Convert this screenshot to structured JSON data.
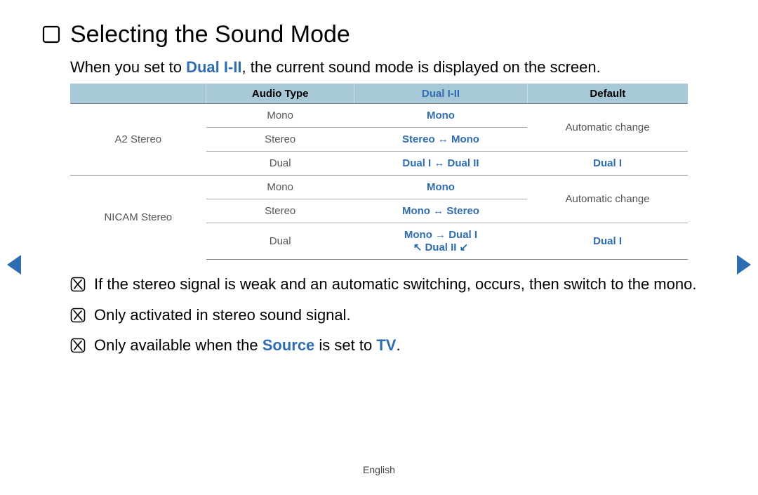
{
  "title": "Selecting the Sound Mode",
  "intro_prefix": "When you set to ",
  "intro_highlight": "Dual I-II",
  "intro_suffix": ", the current sound mode is displayed on the screen.",
  "table": {
    "headers": {
      "col1": "",
      "col2": "Audio Type",
      "col3": "Dual I-II",
      "col4": "Default"
    },
    "a2": {
      "name": "A2 Stereo",
      "rows": [
        {
          "atype": "Mono",
          "dual": "Mono",
          "def": "Automatic change"
        },
        {
          "atype": "Stereo",
          "dual": "Stereo ↔ Mono",
          "def": ""
        },
        {
          "atype": "Dual",
          "dual": "Dual I ↔ Dual II",
          "def": "Dual I"
        }
      ]
    },
    "nicam": {
      "name": "NICAM Stereo",
      "rows": [
        {
          "atype": "Mono",
          "dual": "Mono",
          "def": "Automatic change"
        },
        {
          "atype": "Stereo",
          "dual": "Mono ↔ Stereo",
          "def": ""
        },
        {
          "atype": "Dual",
          "dual_line1": "Mono → Dual I",
          "dual_line2": "↖ Dual II ↙",
          "def": "Dual I"
        }
      ]
    }
  },
  "notes": {
    "n1": "If the stereo signal is weak and an automatic switching, occurs, then switch to the mono.",
    "n2": "Only activated in stereo sound signal.",
    "n3_prefix": "Only available when the ",
    "n3_source": "Source",
    "n3_mid": " is set to ",
    "n3_tv": "TV",
    "n3_suffix": "."
  },
  "footer": "English"
}
